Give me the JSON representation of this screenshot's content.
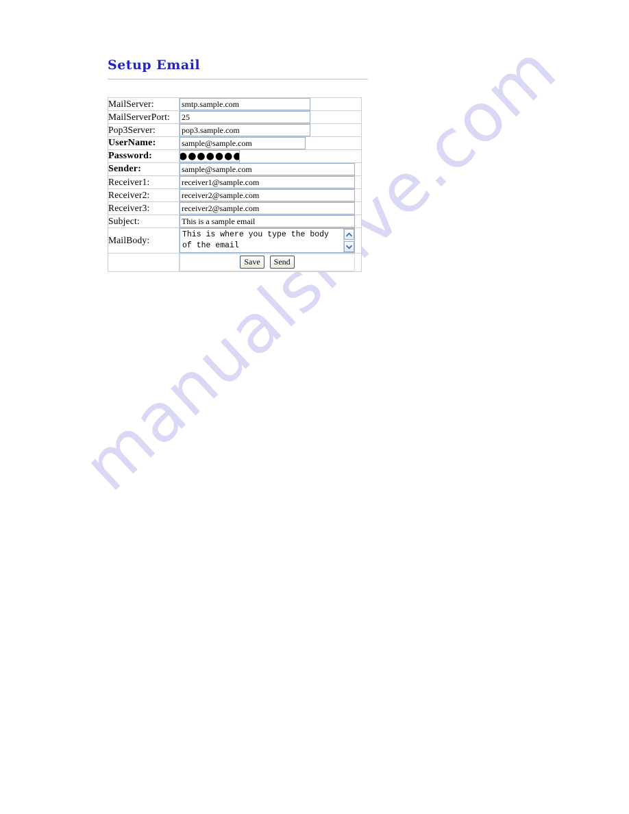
{
  "page": {
    "title": "Setup Email",
    "title_color": "#2323c4",
    "watermark": "manualshive.com",
    "watermark_color": "#d9d8f5"
  },
  "form": {
    "rows": [
      {
        "label": "MailServer:",
        "bold": false,
        "type": "text",
        "value": "smtp.sample.com",
        "width": "w-small"
      },
      {
        "label": "MailServerPort:",
        "bold": false,
        "type": "text",
        "value": "25",
        "width": "w-small"
      },
      {
        "label": "Pop3Server:",
        "bold": false,
        "type": "text",
        "value": "pop3.sample.com",
        "width": "w-small"
      },
      {
        "label": "UserName:",
        "bold": true,
        "type": "text",
        "value": "sample@sample.com",
        "width": "w-user"
      },
      {
        "label": "Password:",
        "bold": true,
        "type": "password",
        "value": "●●●●●●●●",
        "width": "w-pass"
      },
      {
        "label": "Sender:",
        "bold": true,
        "type": "text",
        "value": "sample@sample.com",
        "width": "w-full"
      },
      {
        "label": "Receiver1:",
        "bold": false,
        "type": "text",
        "value": "receiver1@sample.com",
        "width": "w-full"
      },
      {
        "label": "Receiver2:",
        "bold": false,
        "type": "text",
        "value": "receiver2@sample.com",
        "width": "w-full"
      },
      {
        "label": "Receiver3:",
        "bold": false,
        "type": "text",
        "value": "receiver2@sample.com",
        "width": "w-full"
      },
      {
        "label": "Subject:",
        "bold": false,
        "type": "text",
        "value": "This is a sample email",
        "width": "w-full"
      },
      {
        "label": "MailBody:",
        "bold": false,
        "type": "textarea",
        "value": "This is where you type the body of the email",
        "width": "w-full"
      }
    ],
    "buttons": {
      "save_label": "Save",
      "send_label": "Send"
    },
    "scrollbar": {
      "up_icon": "chevron-up-icon",
      "down_icon": "chevron-down-icon"
    }
  }
}
